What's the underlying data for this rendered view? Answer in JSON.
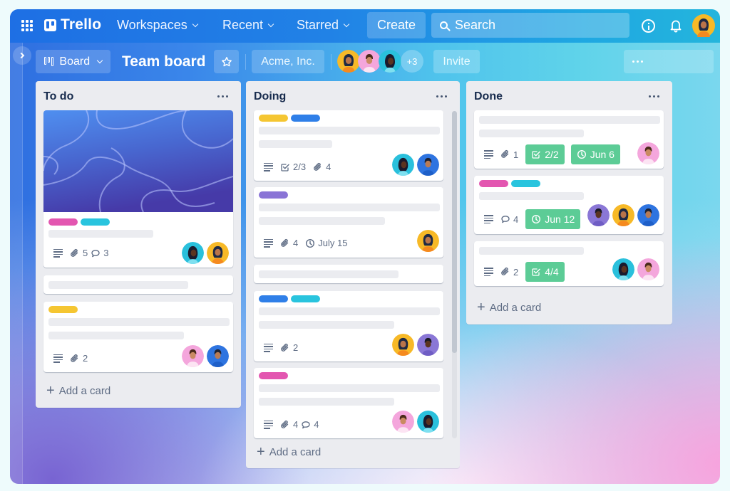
{
  "topnav": {
    "logo_text": "Trello",
    "menus": [
      {
        "label": "Workspaces"
      },
      {
        "label": "Recent"
      },
      {
        "label": "Starred"
      }
    ],
    "create_label": "Create",
    "search_placeholder": "Search"
  },
  "board_header": {
    "view_label": "Board",
    "board_title": "Team board",
    "workspace_label": "Acme, Inc.",
    "extra_members": "+3",
    "invite_label": "Invite"
  },
  "colors": {
    "label_pink": "#e356b0",
    "label_cyan": "#29c4de",
    "label_yellow": "#f5c632",
    "label_blue": "#2f7fe8",
    "label_purple": "#8a74d6",
    "badge_green": "#5ccc96"
  },
  "lists": [
    {
      "title": "To do",
      "add_card_label": "Add a card",
      "cards": [
        {
          "cover": "wavy-blue-pattern",
          "labels": [
            "pink",
            "cyan"
          ],
          "attachments": "5",
          "comments": "3",
          "members": [
            "cyan-woman",
            "yellow-woman"
          ]
        },
        {
          "labels": []
        },
        {
          "labels": [
            "yellow"
          ],
          "attachments": "2",
          "members": [
            "pink-man",
            "blue-man"
          ]
        }
      ]
    },
    {
      "title": "Doing",
      "add_card_label": "Add a card",
      "cards": [
        {
          "labels": [
            "yellow",
            "blue"
          ],
          "checklist": "2/3",
          "attachments": "4",
          "members": [
            "cyan-woman",
            "blue-man"
          ]
        },
        {
          "labels": [
            "purple"
          ],
          "attachments": "4",
          "due": "July 15",
          "members": [
            "yellow-woman"
          ]
        },
        {
          "labels": []
        },
        {
          "labels": [
            "blue",
            "cyan"
          ],
          "attachments": "2",
          "members": [
            "yellow-woman",
            "purple-man"
          ]
        },
        {
          "labels": [
            "pink"
          ],
          "attachments": "4",
          "comments": "4",
          "members": [
            "pink-man",
            "cyan-woman"
          ]
        }
      ]
    },
    {
      "title": "Done",
      "add_card_label": "Add a card",
      "cards": [
        {
          "labels": [],
          "attachments": "1",
          "checklist": "2/2",
          "due": "Jun 6",
          "members": [
            "pink-man"
          ]
        },
        {
          "labels": [
            "pink",
            "cyan"
          ],
          "comments": "4",
          "due": "Jun 12",
          "members": [
            "purple-man",
            "yellow-woman",
            "blue-man"
          ]
        },
        {
          "labels": [],
          "attachments": "2",
          "checklist": "4/4",
          "members": [
            "cyan-woman",
            "pink-man"
          ]
        }
      ]
    }
  ]
}
